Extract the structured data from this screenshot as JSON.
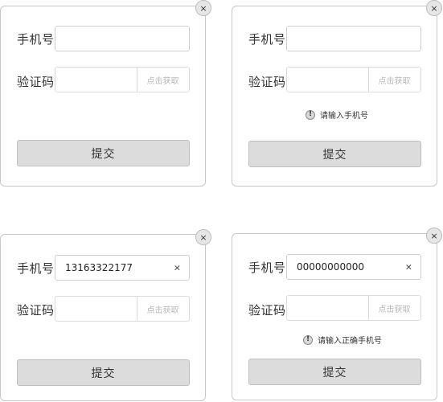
{
  "colors": {
    "border": "#c8c8c8",
    "submit_bg": "#dcdcdc",
    "placeholder_text": "#b8b8b8"
  },
  "labels": {
    "phone": "手机号",
    "code": "验证码",
    "get_code": "点击获取",
    "submit": "提交",
    "close": "×",
    "clear": "×",
    "warn": "!"
  },
  "dialogs": [
    {
      "state": "empty",
      "phone_value": "",
      "error": ""
    },
    {
      "state": "phone-empty-error",
      "phone_value": "",
      "error": "请输入手机号"
    },
    {
      "state": "filled",
      "phone_value": "13163322177",
      "error": ""
    },
    {
      "state": "invalid-phone-error",
      "phone_value": "00000000000",
      "error": "请输入正确手机号"
    }
  ]
}
